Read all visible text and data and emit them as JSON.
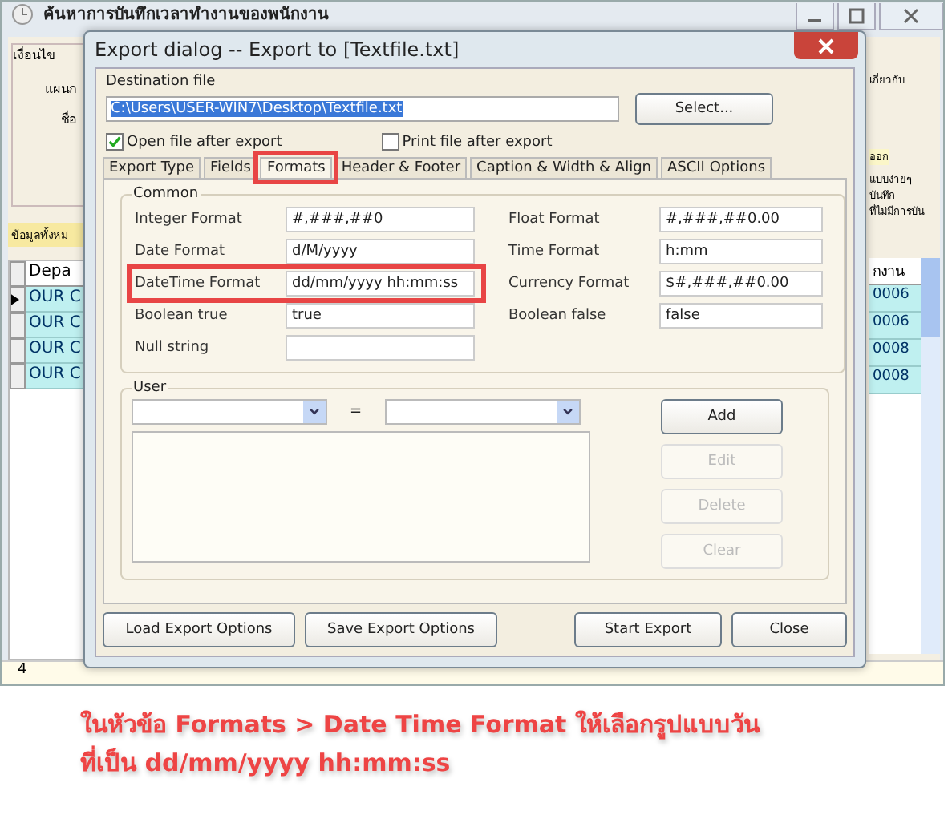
{
  "background_window": {
    "title": "ค้นหาการบันทึกเวลาทำงานของพนักงาน",
    "left_labels": [
      "เงื่อนไข",
      "แผนก",
      "ชื่อ"
    ],
    "right_labels": [
      "เกี่ยวกับ",
      "ออก",
      "แบบง่ายๆ",
      "บันทึก",
      "ที่ไม่มีการบัน"
    ],
    "left_tab": "ข้อมูลทั้งหม",
    "table": {
      "left_header": "Depa",
      "right_header": "กงาน",
      "rows": [
        {
          "column_1": "OUR C",
          "column_2": "0006",
          "selected": true
        },
        {
          "column_1": "OUR C",
          "column_2": "0006",
          "selected": false
        },
        {
          "column_1": "OUR C",
          "column_2": "0008",
          "selected": false
        },
        {
          "column_1": "OUR C",
          "column_2": "0008",
          "selected": false
        }
      ]
    },
    "status_bar": "4"
  },
  "dialog": {
    "title": "Export dialog -- Export to [Textfile.txt]",
    "destination_label": "Destination file",
    "destination_path": "C:\\Users\\USER-WIN7\\Desktop\\Textfile.txt",
    "select_button": "Select...",
    "checkboxes": [
      {
        "label": "Open file after export",
        "checked": true
      },
      {
        "label": "Print file after export",
        "checked": false
      }
    ],
    "tabs": [
      {
        "label": "Export Type",
        "selected": false,
        "highlighted": false
      },
      {
        "label": "Fields",
        "selected": false,
        "highlighted": false
      },
      {
        "label": "Formats",
        "selected": true,
        "highlighted": true
      },
      {
        "label": "Header & Footer",
        "selected": false,
        "highlighted": false
      },
      {
        "label": "Caption & Width & Align",
        "selected": false,
        "highlighted": false
      },
      {
        "label": "ASCII Options",
        "selected": false,
        "highlighted": false
      }
    ],
    "common": {
      "title": "Common",
      "left_fields": [
        {
          "label": "Integer Format",
          "value": "#,###,##0",
          "highlighted": false
        },
        {
          "label": "Date Format",
          "value": "d/M/yyyy",
          "highlighted": false
        },
        {
          "label": "DateTime Format",
          "value": "dd/mm/yyyy hh:mm:ss",
          "highlighted": true
        },
        {
          "label": "Boolean true",
          "value": "true",
          "highlighted": false
        },
        {
          "label": "Null string",
          "highlighted": false
        }
      ],
      "right_fields": [
        {
          "label": "Float Format",
          "value": "#,###,##0.00",
          "highlighted": false
        },
        {
          "label": "Time Format",
          "value": "h:mm",
          "highlighted": false
        },
        {
          "label": "Currency Format",
          "value": "$#,###,##0.00",
          "highlighted": false
        },
        {
          "label": "Boolean false",
          "value": "false",
          "highlighted": false
        }
      ]
    },
    "user": {
      "title": "User",
      "equals": "=",
      "buttons": [
        {
          "label": "Add",
          "disabled": false
        },
        {
          "label": "Edit",
          "disabled": true
        },
        {
          "label": "Delete",
          "disabled": true
        },
        {
          "label": "Clear",
          "disabled": true
        }
      ]
    },
    "footer_buttons": [
      "Load Export Options",
      "Save Export Options",
      "Start Export",
      "Close"
    ]
  },
  "caption": "ในหัวข้อ Formats > Date Time Format ให้เลือกรูปแบบวัน\nที่เป็น dd/mm/yyyy hh:mm:ss"
}
